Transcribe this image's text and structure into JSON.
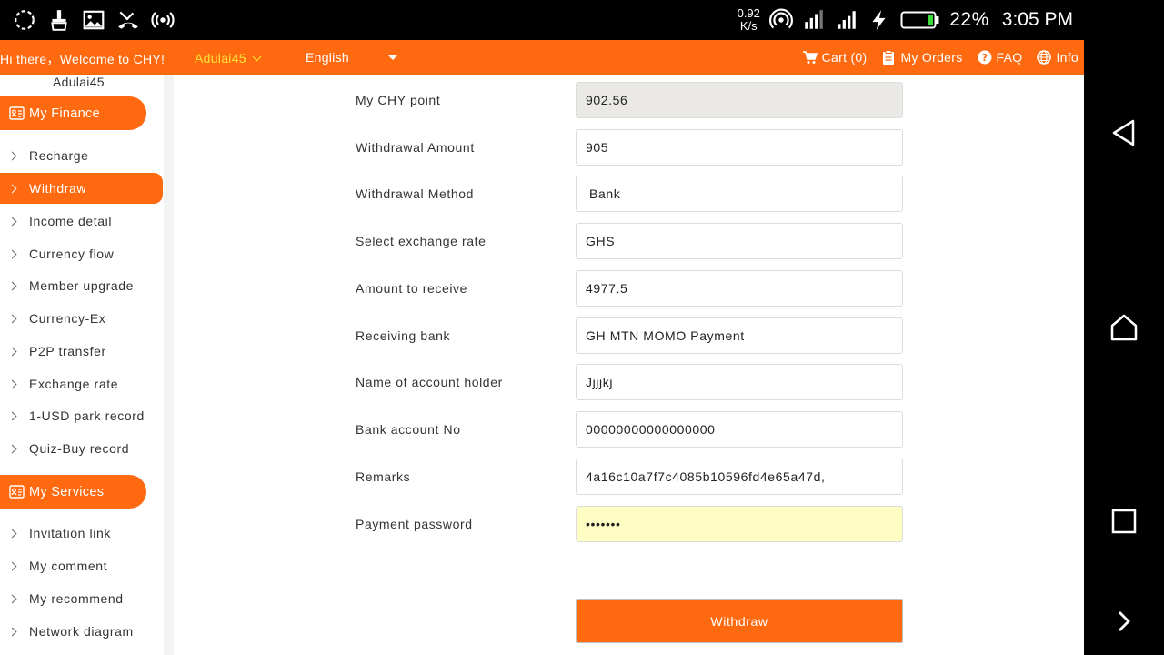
{
  "statusbar": {
    "net_speed_value": "0.92",
    "net_speed_unit": "K/s",
    "battery_percent": "22%",
    "time": "3:05 PM"
  },
  "topbar": {
    "welcome": "Hi there，Welcome to CHY!",
    "username": "Adulai45",
    "language": "English",
    "cart": "Cart (0)",
    "orders": "My Orders",
    "faq": "FAQ",
    "info": "Info"
  },
  "sidebar": {
    "user": "Adulai45",
    "finance_title": "My Finance",
    "finance_items": [
      {
        "label": "Recharge"
      },
      {
        "label": "Withdraw"
      },
      {
        "label": "Income detail"
      },
      {
        "label": "Currency flow"
      },
      {
        "label": "Member upgrade"
      },
      {
        "label": "Currency-Ex"
      },
      {
        "label": "P2P transfer"
      },
      {
        "label": "Exchange rate"
      },
      {
        "label": "1-USD park record"
      },
      {
        "label": "Quiz-Buy record"
      }
    ],
    "services_title": "My Services",
    "services_items": [
      {
        "label": "Invitation link"
      },
      {
        "label": "My comment"
      },
      {
        "label": "My recommend"
      },
      {
        "label": "Network diagram"
      }
    ]
  },
  "form": {
    "fields": [
      {
        "label": "My CHY point",
        "value": "902.56"
      },
      {
        "label": "Withdrawal Amount",
        "value": "905"
      },
      {
        "label": "Withdrawal Method",
        "value": "Bank"
      },
      {
        "label": "Select exchange rate",
        "value": "GHS"
      },
      {
        "label": "Amount to receive",
        "value": "4977.5"
      },
      {
        "label": "Receiving bank",
        "value": "GH MTN MOMO Payment"
      },
      {
        "label": "Name of account holder",
        "value": "Jjjjkj"
      },
      {
        "label": "Bank account No",
        "value": "00000000000000000"
      },
      {
        "label": "Remarks",
        "value": "4a16c10a7f7c4085b10596fd4e65a47d,"
      },
      {
        "label": "Payment password",
        "value": "•••••••"
      }
    ],
    "submit_label": "Withdraw"
  },
  "colors": {
    "accent": "#ff6a10",
    "username": "#ffe23a",
    "password_bg": "#fdfdc4",
    "readonly_bg": "#ebe9e5"
  }
}
